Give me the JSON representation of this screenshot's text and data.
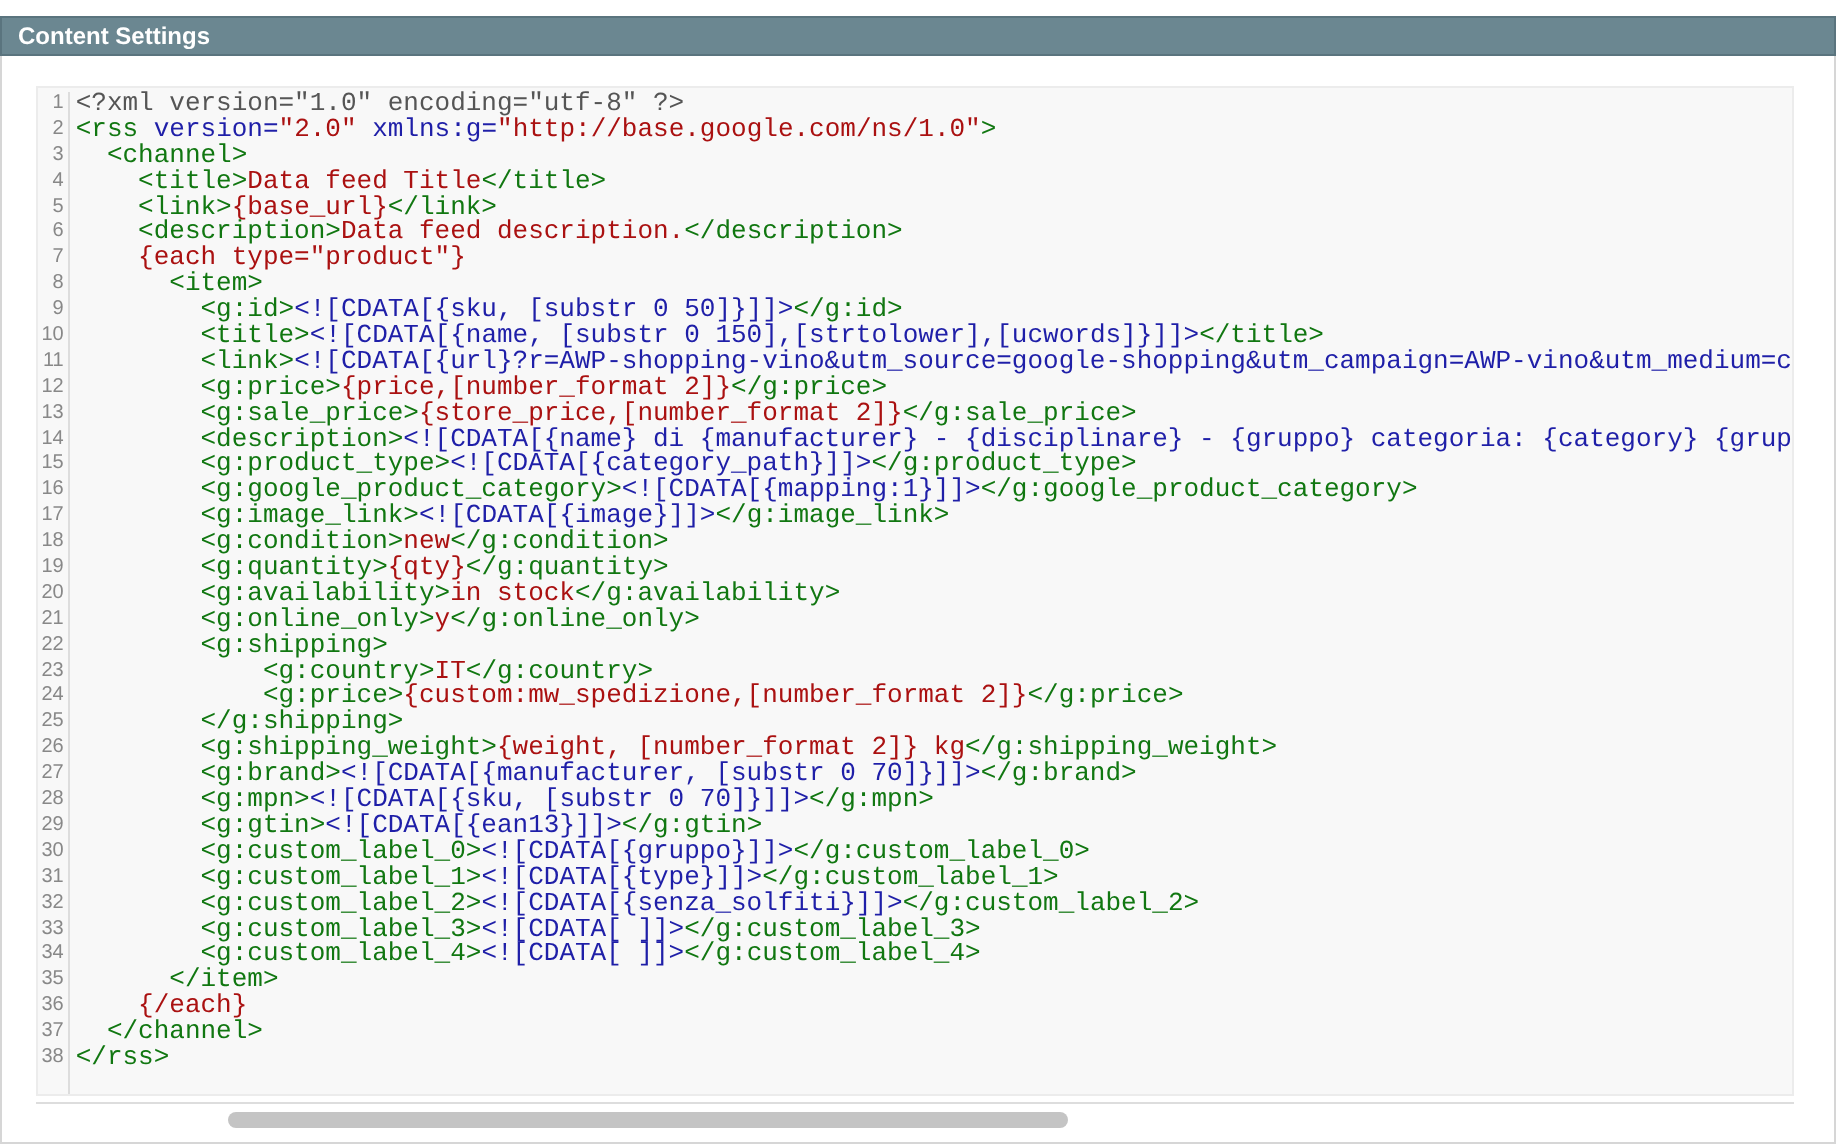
{
  "panel": {
    "title": "Content Settings"
  },
  "editor": {
    "lines": [
      {
        "n": "1",
        "segs": [
          {
            "kind": "meta",
            "text": "<?xml version=\"1.0\" encoding=\"utf-8\" ?>"
          }
        ]
      },
      {
        "n": "2",
        "segs": [
          {
            "kind": "tag",
            "text": "<rss"
          },
          {
            "kind": "attr",
            "text": " version="
          },
          {
            "kind": "str",
            "text": "\"2.0\""
          },
          {
            "kind": "attr",
            "text": " xmlns:g="
          },
          {
            "kind": "str",
            "text": "\"http://base.google.com/ns/1.0\""
          },
          {
            "kind": "tag",
            "text": ">"
          }
        ]
      },
      {
        "n": "3",
        "segs": [
          {
            "kind": "tag",
            "text": "  <channel>"
          }
        ]
      },
      {
        "n": "4",
        "segs": [
          {
            "kind": "tag",
            "text": "    <title>"
          },
          {
            "kind": "text",
            "text": "Data feed Title"
          },
          {
            "kind": "tag",
            "text": "</title>"
          }
        ]
      },
      {
        "n": "5",
        "segs": [
          {
            "kind": "tag",
            "text": "    <link>"
          },
          {
            "kind": "var",
            "text": "{base_url}"
          },
          {
            "kind": "tag",
            "text": "</link>"
          }
        ]
      },
      {
        "n": "6",
        "segs": [
          {
            "kind": "tag",
            "text": "    <description>"
          },
          {
            "kind": "text",
            "text": "Data feed description."
          },
          {
            "kind": "tag",
            "text": "</description>"
          }
        ]
      },
      {
        "n": "7",
        "segs": [
          {
            "kind": "var",
            "text": "    {each type=\"product\"}"
          }
        ]
      },
      {
        "n": "8",
        "segs": [
          {
            "kind": "tag",
            "text": "      <item>"
          }
        ]
      },
      {
        "n": "9",
        "segs": [
          {
            "kind": "tag",
            "text": "        <g:id>"
          },
          {
            "kind": "cdata",
            "text": "<![CDATA[{sku, [substr 0 50]}]]>"
          },
          {
            "kind": "tag",
            "text": "</g:id>"
          }
        ]
      },
      {
        "n": "10",
        "segs": [
          {
            "kind": "tag",
            "text": "        <title>"
          },
          {
            "kind": "cdata",
            "text": "<![CDATA[{name, [substr 0 150],[strtolower],[ucwords]}]]>"
          },
          {
            "kind": "tag",
            "text": "</title>"
          }
        ]
      },
      {
        "n": "11",
        "segs": [
          {
            "kind": "tag",
            "text": "        <link>"
          },
          {
            "kind": "cdata",
            "text": "<![CDATA[{url}?r=AWP-shopping-vino&utm_source=google-shopping&utm_campaign=AWP-vino&utm_medium=c"
          }
        ]
      },
      {
        "n": "12",
        "segs": [
          {
            "kind": "tag",
            "text": "        <g:price>"
          },
          {
            "kind": "var",
            "text": "{price,[number_format 2]}"
          },
          {
            "kind": "tag",
            "text": "</g:price>"
          }
        ]
      },
      {
        "n": "13",
        "segs": [
          {
            "kind": "tag",
            "text": "        <g:sale_price>"
          },
          {
            "kind": "var",
            "text": "{store_price,[number_format 2]}"
          },
          {
            "kind": "tag",
            "text": "</g:sale_price>"
          }
        ]
      },
      {
        "n": "14",
        "segs": [
          {
            "kind": "tag",
            "text": "        <description>"
          },
          {
            "kind": "cdata",
            "text": "<![CDATA[{name} di {manufacturer} - {disciplinare} - {gruppo} categoria: {category} {grup"
          }
        ]
      },
      {
        "n": "15",
        "segs": [
          {
            "kind": "tag",
            "text": "        <g:product_type>"
          },
          {
            "kind": "cdata",
            "text": "<![CDATA[{category_path}]]>"
          },
          {
            "kind": "tag",
            "text": "</g:product_type>"
          }
        ]
      },
      {
        "n": "16",
        "segs": [
          {
            "kind": "tag",
            "text": "        <g:google_product_category>"
          },
          {
            "kind": "cdata",
            "text": "<![CDATA[{mapping:1}]]>"
          },
          {
            "kind": "tag",
            "text": "</g:google_product_category>"
          }
        ]
      },
      {
        "n": "17",
        "segs": [
          {
            "kind": "tag",
            "text": "        <g:image_link>"
          },
          {
            "kind": "cdata",
            "text": "<![CDATA[{image}]]>"
          },
          {
            "kind": "tag",
            "text": "</g:image_link>"
          }
        ]
      },
      {
        "n": "18",
        "segs": [
          {
            "kind": "tag",
            "text": "        <g:condition>"
          },
          {
            "kind": "text",
            "text": "new"
          },
          {
            "kind": "tag",
            "text": "</g:condition>"
          }
        ]
      },
      {
        "n": "19",
        "segs": [
          {
            "kind": "tag",
            "text": "        <g:quantity>"
          },
          {
            "kind": "var",
            "text": "{qty}"
          },
          {
            "kind": "tag",
            "text": "</g:quantity>"
          }
        ]
      },
      {
        "n": "20",
        "segs": [
          {
            "kind": "tag",
            "text": "        <g:availability>"
          },
          {
            "kind": "text",
            "text": "in stock"
          },
          {
            "kind": "tag",
            "text": "</g:availability>"
          }
        ]
      },
      {
        "n": "21",
        "segs": [
          {
            "kind": "tag",
            "text": "        <g:online_only>"
          },
          {
            "kind": "text",
            "text": "y"
          },
          {
            "kind": "tag",
            "text": "</g:online_only>"
          }
        ]
      },
      {
        "n": "22",
        "segs": [
          {
            "kind": "tag",
            "text": "        <g:shipping>"
          }
        ]
      },
      {
        "n": "23",
        "segs": [
          {
            "kind": "tag",
            "text": "            <g:country>"
          },
          {
            "kind": "text",
            "text": "IT"
          },
          {
            "kind": "tag",
            "text": "</g:country>"
          }
        ]
      },
      {
        "n": "24",
        "segs": [
          {
            "kind": "tag",
            "text": "            <g:price>"
          },
          {
            "kind": "var",
            "text": "{custom:mw_spedizione,[number_format 2]}"
          },
          {
            "kind": "tag",
            "text": "</g:price>"
          }
        ]
      },
      {
        "n": "25",
        "segs": [
          {
            "kind": "tag",
            "text": "        </g:shipping>"
          }
        ]
      },
      {
        "n": "26",
        "segs": [
          {
            "kind": "tag",
            "text": "        <g:shipping_weight>"
          },
          {
            "kind": "var",
            "text": "{weight, [number_format 2]} kg"
          },
          {
            "kind": "tag",
            "text": "</g:shipping_weight>"
          }
        ]
      },
      {
        "n": "27",
        "segs": [
          {
            "kind": "tag",
            "text": "        <g:brand>"
          },
          {
            "kind": "cdata",
            "text": "<![CDATA[{manufacturer, [substr 0 70]}]]>"
          },
          {
            "kind": "tag",
            "text": "</g:brand>"
          }
        ]
      },
      {
        "n": "28",
        "segs": [
          {
            "kind": "tag",
            "text": "        <g:mpn>"
          },
          {
            "kind": "cdata",
            "text": "<![CDATA[{sku, [substr 0 70]}]]>"
          },
          {
            "kind": "tag",
            "text": "</g:mpn>"
          }
        ]
      },
      {
        "n": "29",
        "segs": [
          {
            "kind": "tag",
            "text": "        <g:gtin>"
          },
          {
            "kind": "cdata",
            "text": "<![CDATA[{ean13}]]>"
          },
          {
            "kind": "tag",
            "text": "</g:gtin>"
          }
        ]
      },
      {
        "n": "30",
        "segs": [
          {
            "kind": "tag",
            "text": "        <g:custom_label_0>"
          },
          {
            "kind": "cdata",
            "text": "<![CDATA[{gruppo}]]>"
          },
          {
            "kind": "tag",
            "text": "</g:custom_label_0>"
          }
        ]
      },
      {
        "n": "31",
        "segs": [
          {
            "kind": "tag",
            "text": "        <g:custom_label_1>"
          },
          {
            "kind": "cdata",
            "text": "<![CDATA[{type}]]>"
          },
          {
            "kind": "tag",
            "text": "</g:custom_label_1>"
          }
        ]
      },
      {
        "n": "32",
        "segs": [
          {
            "kind": "tag",
            "text": "        <g:custom_label_2>"
          },
          {
            "kind": "cdata",
            "text": "<![CDATA[{senza_solfiti}]]>"
          },
          {
            "kind": "tag",
            "text": "</g:custom_label_2>"
          }
        ]
      },
      {
        "n": "33",
        "segs": [
          {
            "kind": "tag",
            "text": "        <g:custom_label_3>"
          },
          {
            "kind": "cdata",
            "text": "<![CDATA[ ]]>"
          },
          {
            "kind": "tag",
            "text": "</g:custom_label_3>"
          }
        ]
      },
      {
        "n": "34",
        "segs": [
          {
            "kind": "tag",
            "text": "        <g:custom_label_4>"
          },
          {
            "kind": "cdata",
            "text": "<![CDATA[ ]]>"
          },
          {
            "kind": "tag",
            "text": "</g:custom_label_4>"
          }
        ]
      },
      {
        "n": "35",
        "segs": [
          {
            "kind": "tag",
            "text": "      </item>"
          }
        ]
      },
      {
        "n": "36",
        "segs": [
          {
            "kind": "var",
            "text": "    {/each}"
          }
        ]
      },
      {
        "n": "37",
        "segs": [
          {
            "kind": "tag",
            "text": "  </channel>"
          }
        ]
      },
      {
        "n": "38",
        "segs": [
          {
            "kind": "tag",
            "text": "</rss>"
          }
        ]
      }
    ]
  }
}
